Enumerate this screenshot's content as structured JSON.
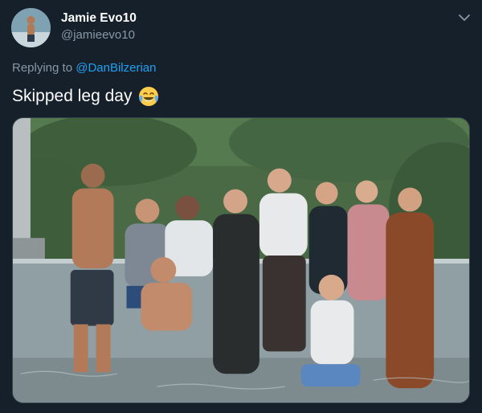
{
  "author": {
    "display_name": "Jamie Evo10",
    "handle": "@jamieevo10",
    "avatar_icon": "profile-photo"
  },
  "reply": {
    "prefix": "Replying to ",
    "mention": "@DanBilzerian"
  },
  "tweet": {
    "text": "Skipped leg day",
    "emoji": "face-with-tears-of-joy"
  },
  "menu": {
    "icon": "chevron-down-icon"
  },
  "media": {
    "kind": "photo",
    "subject": "group-in-infinity-pool"
  },
  "colors": {
    "background": "#15202b",
    "text_primary": "#ffffff",
    "text_secondary": "#8899a6",
    "link": "#1da1f2"
  }
}
